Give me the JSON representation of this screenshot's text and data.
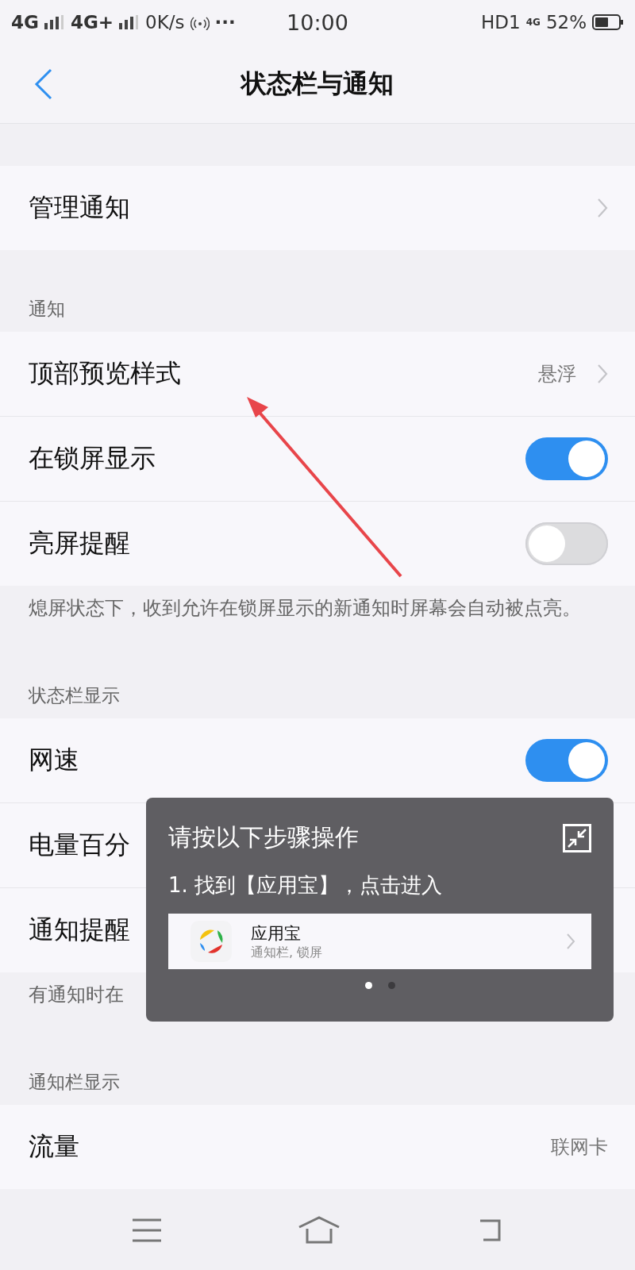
{
  "status_bar": {
    "sim1": "4G",
    "sim2": "4G+",
    "speed": "0K/s",
    "more": "···",
    "time": "10:00",
    "hd": "HD1",
    "net": "4G",
    "battery": "52%"
  },
  "header": {
    "title": "状态栏与通知"
  },
  "sections": [
    {
      "rows": [
        {
          "kind": "link",
          "label": "管理通知"
        }
      ]
    },
    {
      "title": "通知",
      "rows": [
        {
          "kind": "link",
          "label": "顶部预览样式",
          "value": "悬浮"
        },
        {
          "kind": "toggle",
          "label": "在锁屏显示",
          "on": true
        },
        {
          "kind": "toggle",
          "label": "亮屏提醒",
          "on": false
        }
      ],
      "note": "熄屏状态下，收到允许在锁屏显示的新通知时屏幕会自动被点亮。"
    },
    {
      "title": "状态栏显示",
      "rows": [
        {
          "kind": "toggle",
          "label": "网速",
          "on": true
        },
        {
          "kind": "value",
          "label": "电量百分"
        },
        {
          "kind": "value",
          "label": "通知提醒"
        }
      ],
      "note": "有通知时在"
    },
    {
      "title": "通知栏显示",
      "rows": [
        {
          "kind": "value",
          "label": "流量",
          "value": "联网卡"
        }
      ]
    }
  ],
  "guide": {
    "title": "请按以下步骤操作",
    "step": "1. 找到【应用宝】，点击进入",
    "app": {
      "name": "应用宝",
      "detail": "通知栏, 锁屏"
    },
    "pages": [
      {
        "selected": true
      },
      {
        "selected": false
      }
    ]
  }
}
